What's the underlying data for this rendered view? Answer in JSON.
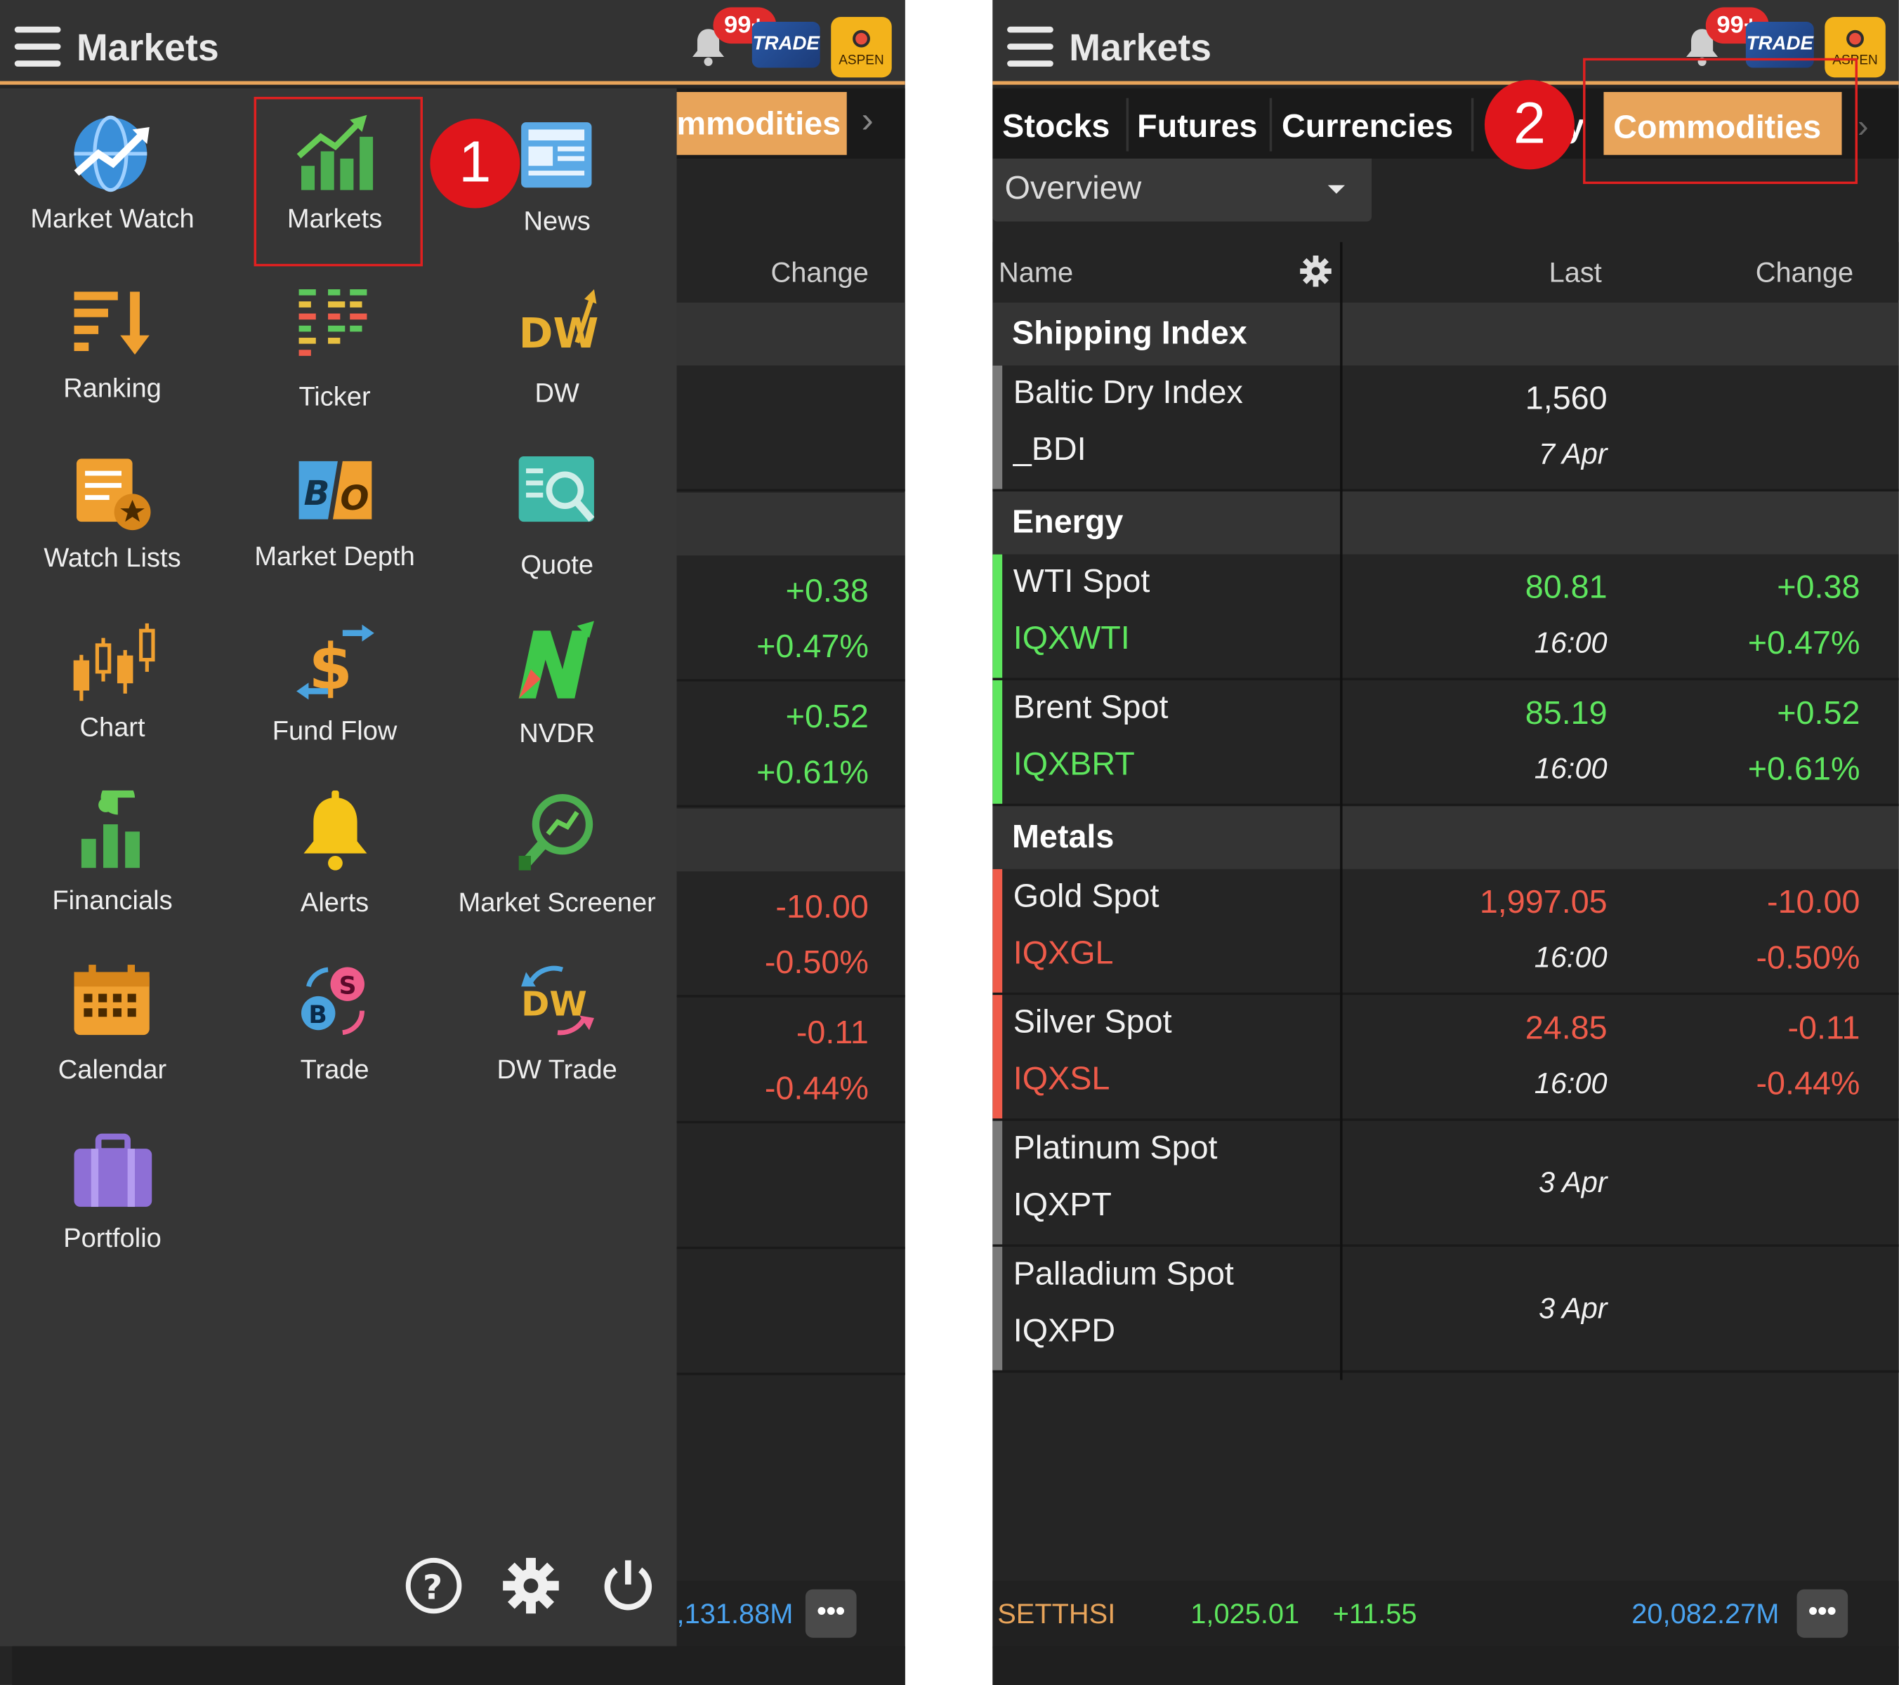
{
  "header": {
    "title": "Markets",
    "badge": "99+",
    "trade_icon": "TRADE",
    "aspen_icon": "ASPEN"
  },
  "step_labels": [
    "1",
    "2"
  ],
  "left": {
    "background_tab": "mmodities",
    "background_col_change": "Change",
    "background_values": [
      {
        "change": "+0.38",
        "pct": "+0.47%",
        "color": "#5ee65e"
      },
      {
        "change": "+0.52",
        "pct": "+0.61%",
        "color": "#5ee65e"
      },
      {
        "change": "-10.00",
        "pct": "-0.50%",
        "color": "#ef5b4a"
      },
      {
        "change": "-0.11",
        "pct": "-0.44%",
        "color": "#ef5b4a"
      }
    ],
    "menu_items": [
      {
        "label": "Market Watch",
        "icon": "globe-chart-icon"
      },
      {
        "label": "Markets",
        "icon": "bar-chart-up-icon"
      },
      {
        "label": "News",
        "icon": "newspaper-icon"
      },
      {
        "label": "Ranking",
        "icon": "ranking-sort-icon"
      },
      {
        "label": "Ticker",
        "icon": "ticker-bars-icon"
      },
      {
        "label": "DW",
        "icon": "dw-icon"
      },
      {
        "label": "Watch Lists",
        "icon": "watchlist-star-icon"
      },
      {
        "label": "Market Depth",
        "icon": "bid-offer-icon"
      },
      {
        "label": "Quote",
        "icon": "quote-magnifier-icon"
      },
      {
        "label": "Chart",
        "icon": "candlestick-icon"
      },
      {
        "label": "Fund Flow",
        "icon": "fund-flow-icon"
      },
      {
        "label": "NVDR",
        "icon": "nvdr-icon"
      },
      {
        "label": "Financials",
        "icon": "financials-icon"
      },
      {
        "label": "Alerts",
        "icon": "bell-icon"
      },
      {
        "label": "Market Screener",
        "icon": "screener-icon"
      },
      {
        "label": "Calendar",
        "icon": "calendar-icon"
      },
      {
        "label": "Trade",
        "icon": "buy-sell-icon"
      },
      {
        "label": "DW Trade",
        "icon": "dw-trade-icon"
      },
      {
        "label": "Portfolio",
        "icon": "portfolio-icon"
      }
    ],
    "footer_icons": [
      "help-icon",
      "settings-icon",
      "power-icon"
    ],
    "status_value": ",131.88M",
    "more": "•••"
  },
  "right": {
    "tabs": [
      "Stocks",
      "Futures",
      "Currencies",
      "y",
      "Commodities"
    ],
    "active_tab": "Commodities",
    "dropdown": "Overview",
    "columns": {
      "name": "Name",
      "last": "Last",
      "change": "Change"
    },
    "sections": [
      {
        "title": "Shipping Index",
        "rows": [
          {
            "name": "Baltic Dry Index",
            "code": "_BDI",
            "last": "1,560",
            "time": "7 Apr",
            "change": "",
            "pct": "",
            "color": "#f2f2f2",
            "indicator": "#7a7a7a"
          }
        ]
      },
      {
        "title": "Energy",
        "rows": [
          {
            "name": "WTI Spot",
            "code": "IQXWTI",
            "last": "80.81",
            "time": "16:00",
            "change": "+0.38",
            "pct": "+0.47%",
            "color": "#5ee65e",
            "indicator": "#5ee65e"
          },
          {
            "name": "Brent Spot",
            "code": "IQXBRT",
            "last": "85.19",
            "time": "16:00",
            "change": "+0.52",
            "pct": "+0.61%",
            "color": "#5ee65e",
            "indicator": "#5ee65e"
          }
        ]
      },
      {
        "title": "Metals",
        "rows": [
          {
            "name": "Gold Spot",
            "code": "IQXGL",
            "last": "1,997.05",
            "time": "16:00",
            "change": "-10.00",
            "pct": "-0.50%",
            "color": "#ef5b4a",
            "indicator": "#ef5b4a"
          },
          {
            "name": "Silver Spot",
            "code": "IQXSL",
            "last": "24.85",
            "time": "16:00",
            "change": "-0.11",
            "pct": "-0.44%",
            "color": "#ef5b4a",
            "indicator": "#ef5b4a"
          },
          {
            "name": "Platinum Spot",
            "code": "IQXPT",
            "last": "",
            "time": "3 Apr",
            "change": "",
            "pct": "",
            "color": "#f2f2f2",
            "indicator": "#7a7a7a"
          },
          {
            "name": "Palladium Spot",
            "code": "IQXPD",
            "last": "",
            "time": "3 Apr",
            "change": "",
            "pct": "",
            "color": "#f2f2f2",
            "indicator": "#7a7a7a"
          }
        ]
      }
    ],
    "status": {
      "index": "SETTHSI",
      "value": "1,025.01",
      "change": "+11.55",
      "volume": "20,082.27M",
      "more": "•••"
    }
  }
}
